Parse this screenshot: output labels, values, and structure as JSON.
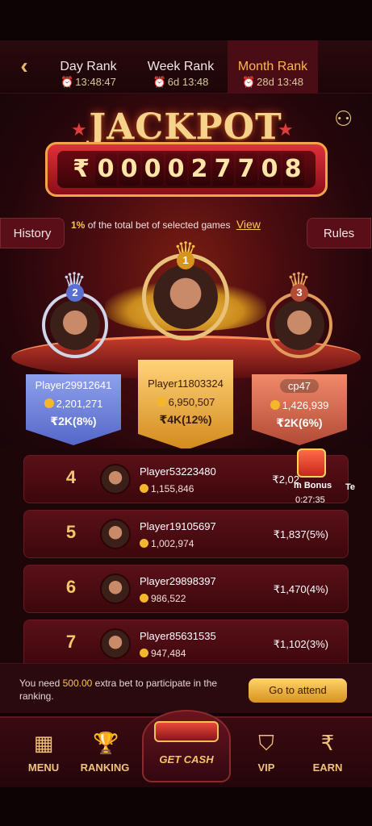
{
  "header": {
    "tabs": [
      {
        "label": "Day Rank",
        "timer": "13:48:47"
      },
      {
        "label": "Week Rank",
        "timer": "6d 13:48"
      },
      {
        "label": "Month Rank",
        "timer": "28d 13:48"
      }
    ]
  },
  "jackpot": {
    "title": "JACKPOT",
    "currency": "₹",
    "digits": [
      "0",
      "0",
      "0",
      "0",
      "2",
      "7",
      "7",
      "0",
      "8"
    ],
    "note_pct": "1%",
    "note_text": "of the total bet of selected games",
    "view_label": "View"
  },
  "side_buttons": {
    "history": "History",
    "rules": "Rules"
  },
  "podium": {
    "first": {
      "rank": "1",
      "player": "Player11803324",
      "score": "6,950,507",
      "prize": "₹4K(12%)"
    },
    "second": {
      "rank": "2",
      "player": "Player29912641",
      "score": "2,201,271",
      "prize": "₹2K(8%)"
    },
    "third": {
      "rank": "3",
      "player": "cp47",
      "score": "1,426,939",
      "prize": "₹2K(6%)"
    }
  },
  "ranking": [
    {
      "rank": "4",
      "player": "Player53223480",
      "score": "1,155,846",
      "prize": "₹2,02"
    },
    {
      "rank": "5",
      "player": "Player19105697",
      "score": "1,002,974",
      "prize": "₹1,837(5%)"
    },
    {
      "rank": "6",
      "player": "Player29898397",
      "score": "986,522",
      "prize": "₹1,470(4%)"
    },
    {
      "rank": "7",
      "player": "Player85631535",
      "score": "947,484",
      "prize": "₹1,102(3%)"
    }
  ],
  "bonus": {
    "label": "m Bonus",
    "timer": "0:27:35",
    "extra": "Te"
  },
  "attend": {
    "text_prefix": "You need",
    "amount": "500.00",
    "text_suffix": "extra bet to participate in the ranking.",
    "button": "Go to attend"
  },
  "nav": {
    "menu": "MENU",
    "ranking": "RANKING",
    "getcash": "GET CASH",
    "vip": "VIP",
    "earn": "EARN"
  }
}
